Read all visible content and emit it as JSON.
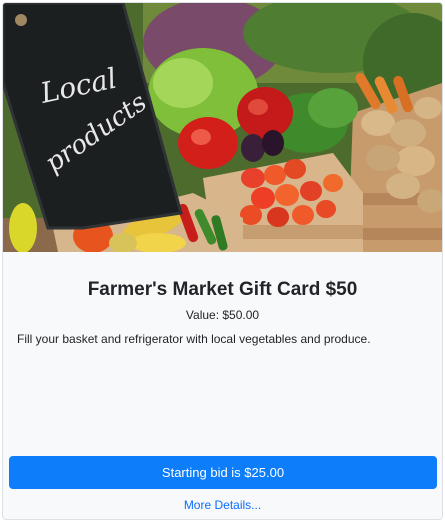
{
  "image": {
    "alt": "Local products chalkboard with crates of vegetables",
    "chalk_text": "Local products"
  },
  "card": {
    "title": "Farmer's Market Gift Card $50",
    "value_text": "Value: $50.00",
    "description": "Fill your basket and refrigerator with local vegetables and produce."
  },
  "actions": {
    "bid_label": "Starting bid is $25.00",
    "details_label": "More Details..."
  },
  "colors": {
    "primary": "#0d7dfa",
    "link": "#0d6efd",
    "card_bg": "#f8f9fa"
  }
}
